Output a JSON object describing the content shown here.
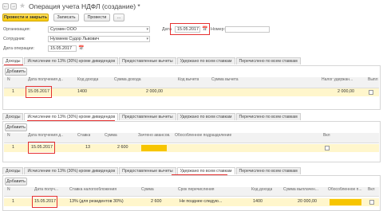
{
  "window": {
    "title": "Операция учета НДФЛ (создание) *"
  },
  "toolbar": {
    "post_close": "Провести и закрыть",
    "save": "Записать",
    "post": "Провести",
    "ellipsis": "..."
  },
  "form": {
    "org_label": "Организация:",
    "org_value": "Сусмин ООО",
    "date_label": "Дата",
    "date_value": "15.05.2017",
    "no_label": "Номер:",
    "no_value": "",
    "employee_label": "Сотрудник:",
    "employee_value": "Нухмеев Судор Львович",
    "opdate_label": "Дата операции:",
    "opdate_value": "15.05.2017"
  },
  "tabs_all": [
    "Доходы",
    "Исчисление по 13% (30%) кроме дивидендов",
    "Предоставленные вычеты",
    "Удержано по всем ставкам",
    "Перечислено по всем ставкам"
  ],
  "add_button": "Добавить",
  "section1": {
    "headers": [
      "N",
      "Дата получения д...",
      "Код дохода",
      "Сумма дохода",
      "Код вычета",
      "Сумма вычета",
      "Налог удержан...",
      "Выпл"
    ],
    "row": {
      "n": "1",
      "date": "15.05.2017",
      "code": "1400",
      "sum": "2 000,00",
      "deduct_code": "",
      "deduct_sum": "",
      "tax": "2 000,00"
    }
  },
  "section2": {
    "headers": [
      "N",
      "Дата получения д...",
      "Ставка",
      "Сумма",
      "Зачтено авансов...",
      "Обособленное подразделение",
      "Вкл"
    ],
    "row": {
      "n": "1",
      "date": "15.05.2017",
      "rate": "13",
      "sum": "2 600",
      "advance": "",
      "division": ""
    }
  },
  "section3": {
    "headers": [
      "N",
      "Дата получ...",
      "Ставка налогообложения",
      "Сумма",
      "Срок перечисления",
      "Код дохода",
      "Сумма выплачен...",
      "Обособленное п...",
      "Вкл"
    ],
    "row": {
      "n": "1",
      "date": "15.05.2017",
      "rate": "13% (для резидентов 30%)",
      "sum": "2 600",
      "deadline": "Не позднее следую...",
      "code": "1400",
      "paid": "20 000,00"
    }
  },
  "colors": {
    "accent": "#f6c800",
    "highlight": "#e53030",
    "row": "#fff6cc"
  }
}
